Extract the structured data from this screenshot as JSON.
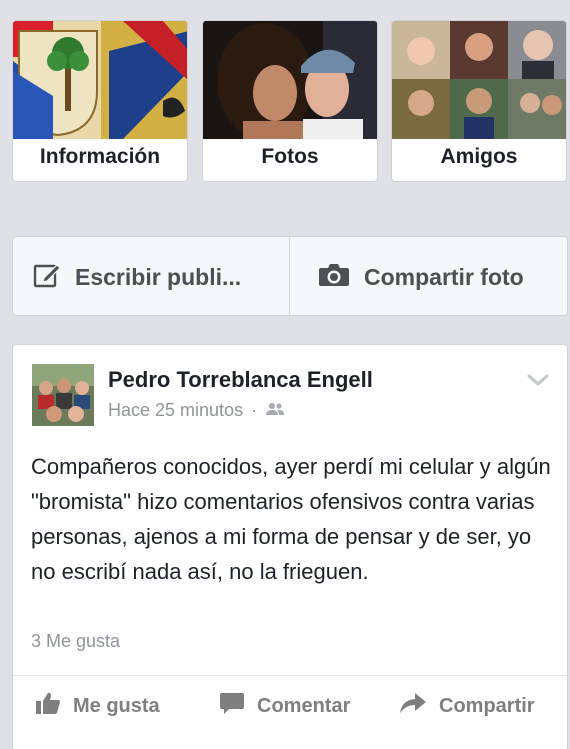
{
  "tiles": [
    {
      "label": "Información",
      "thumb_icon": "coat-of-arms-thumbnail"
    },
    {
      "label": "Fotos",
      "thumb_icon": "couple-photo-thumbnail"
    },
    {
      "label": "Amigos",
      "thumb_icon": "friends-grid-thumbnail"
    }
  ],
  "composer": {
    "write_label": "Escribir publi...",
    "write_icon": "pencil-square-icon",
    "photo_label": "Compartir foto",
    "photo_icon": "camera-icon"
  },
  "post": {
    "author": "Pedro Torreblanca Engell",
    "time": "Hace 25 minutos",
    "audience_icon": "friends-audience-icon",
    "text": "Compañeros conocidos, ayer perdí mi celular y algún \"bromista\" hizo comentarios ofensivos contra varias personas, ajenos a mi forma de pensar y de ser, yo no escribí nada así, no la frieguen.",
    "likes": "3 Me gusta",
    "actions": {
      "like": "Me gusta",
      "comment": "Comentar",
      "share": "Compartir"
    }
  },
  "colors": {
    "background": "#dfe1e6",
    "card": "#ffffff",
    "text": "#1d2129",
    "muted": "#90949c",
    "action": "#7f7f7f"
  }
}
